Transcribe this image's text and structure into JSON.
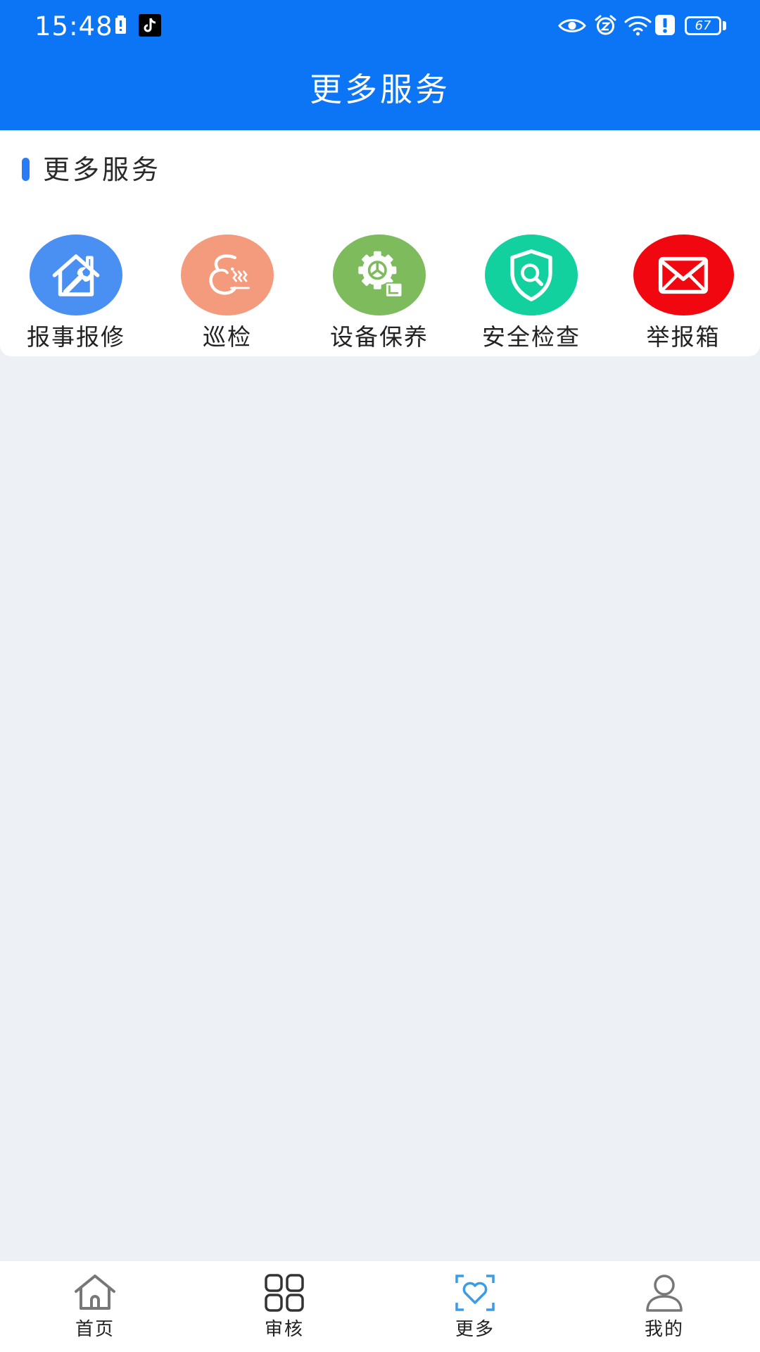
{
  "status_bar": {
    "time": "15:48",
    "battery": "67"
  },
  "header": {
    "title": "更多服务"
  },
  "section": {
    "title": "更多服务"
  },
  "services": [
    {
      "label": "报事报修",
      "icon": "house-repair-icon",
      "color": "#4a8ff2"
    },
    {
      "label": "巡检",
      "icon": "patrol-icon",
      "color": "#f59b7d"
    },
    {
      "label": "设备保养",
      "icon": "gear-maintenance-icon",
      "color": "#7dbb5d"
    },
    {
      "label": "安全检查",
      "icon": "shield-search-icon",
      "color": "#12d19f"
    },
    {
      "label": "举报箱",
      "icon": "envelope-icon",
      "color": "#f0070f"
    }
  ],
  "nav": [
    {
      "label": "首页",
      "icon": "home-icon",
      "active": false
    },
    {
      "label": "审核",
      "icon": "grid-icon",
      "active": false
    },
    {
      "label": "更多",
      "icon": "heart-scan-icon",
      "active": true
    },
    {
      "label": "我的",
      "icon": "user-icon",
      "active": false
    }
  ],
  "colors": {
    "primary": "#0c75f5",
    "background": "#edf1f5",
    "section_accent": "#2a7cf6",
    "nav_active_icon": "#3a9be6"
  }
}
